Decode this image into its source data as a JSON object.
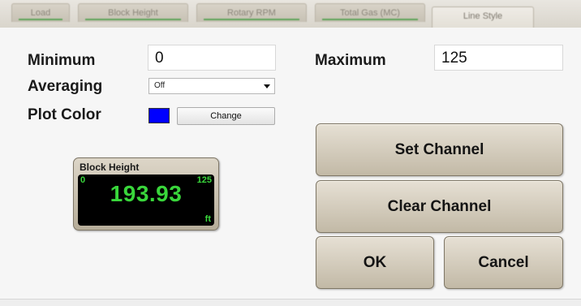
{
  "tabs": [
    {
      "label": "Load"
    },
    {
      "label": "Block Height"
    },
    {
      "label": "Rotary RPM"
    },
    {
      "label": "Total Gas (MC)"
    },
    {
      "label": "Line Style"
    }
  ],
  "form": {
    "minimum_label": "Minimum",
    "minimum_value": "0",
    "maximum_label": "Maximum",
    "maximum_value": "125",
    "averaging_label": "Averaging",
    "averaging_value": "Off",
    "plot_color_label": "Plot Color",
    "plot_color": "#0000ff",
    "change_label": "Change"
  },
  "gauge": {
    "title": "Block Height",
    "min": "0",
    "max": "125",
    "value": "193.93",
    "unit": "ft",
    "color": "#39d63b"
  },
  "buttons": {
    "set_channel": "Set Channel",
    "clear_channel": "Clear Channel",
    "ok": "OK",
    "cancel": "Cancel"
  }
}
